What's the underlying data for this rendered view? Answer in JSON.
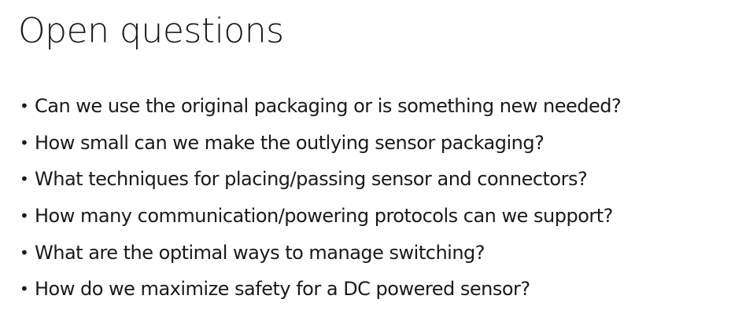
{
  "slide": {
    "title": "Open questions",
    "bullet_glyph": "•",
    "bullets": [
      "Can we use the original packaging or is something new needed?",
      "How small can we make the outlying sensor packaging?",
      "What techniques for placing/passing sensor and connectors?",
      "How many communication/powering protocols can we support?",
      "What are the optimal ways to manage switching?",
      "How do we maximize safety for a DC powered sensor?"
    ]
  }
}
